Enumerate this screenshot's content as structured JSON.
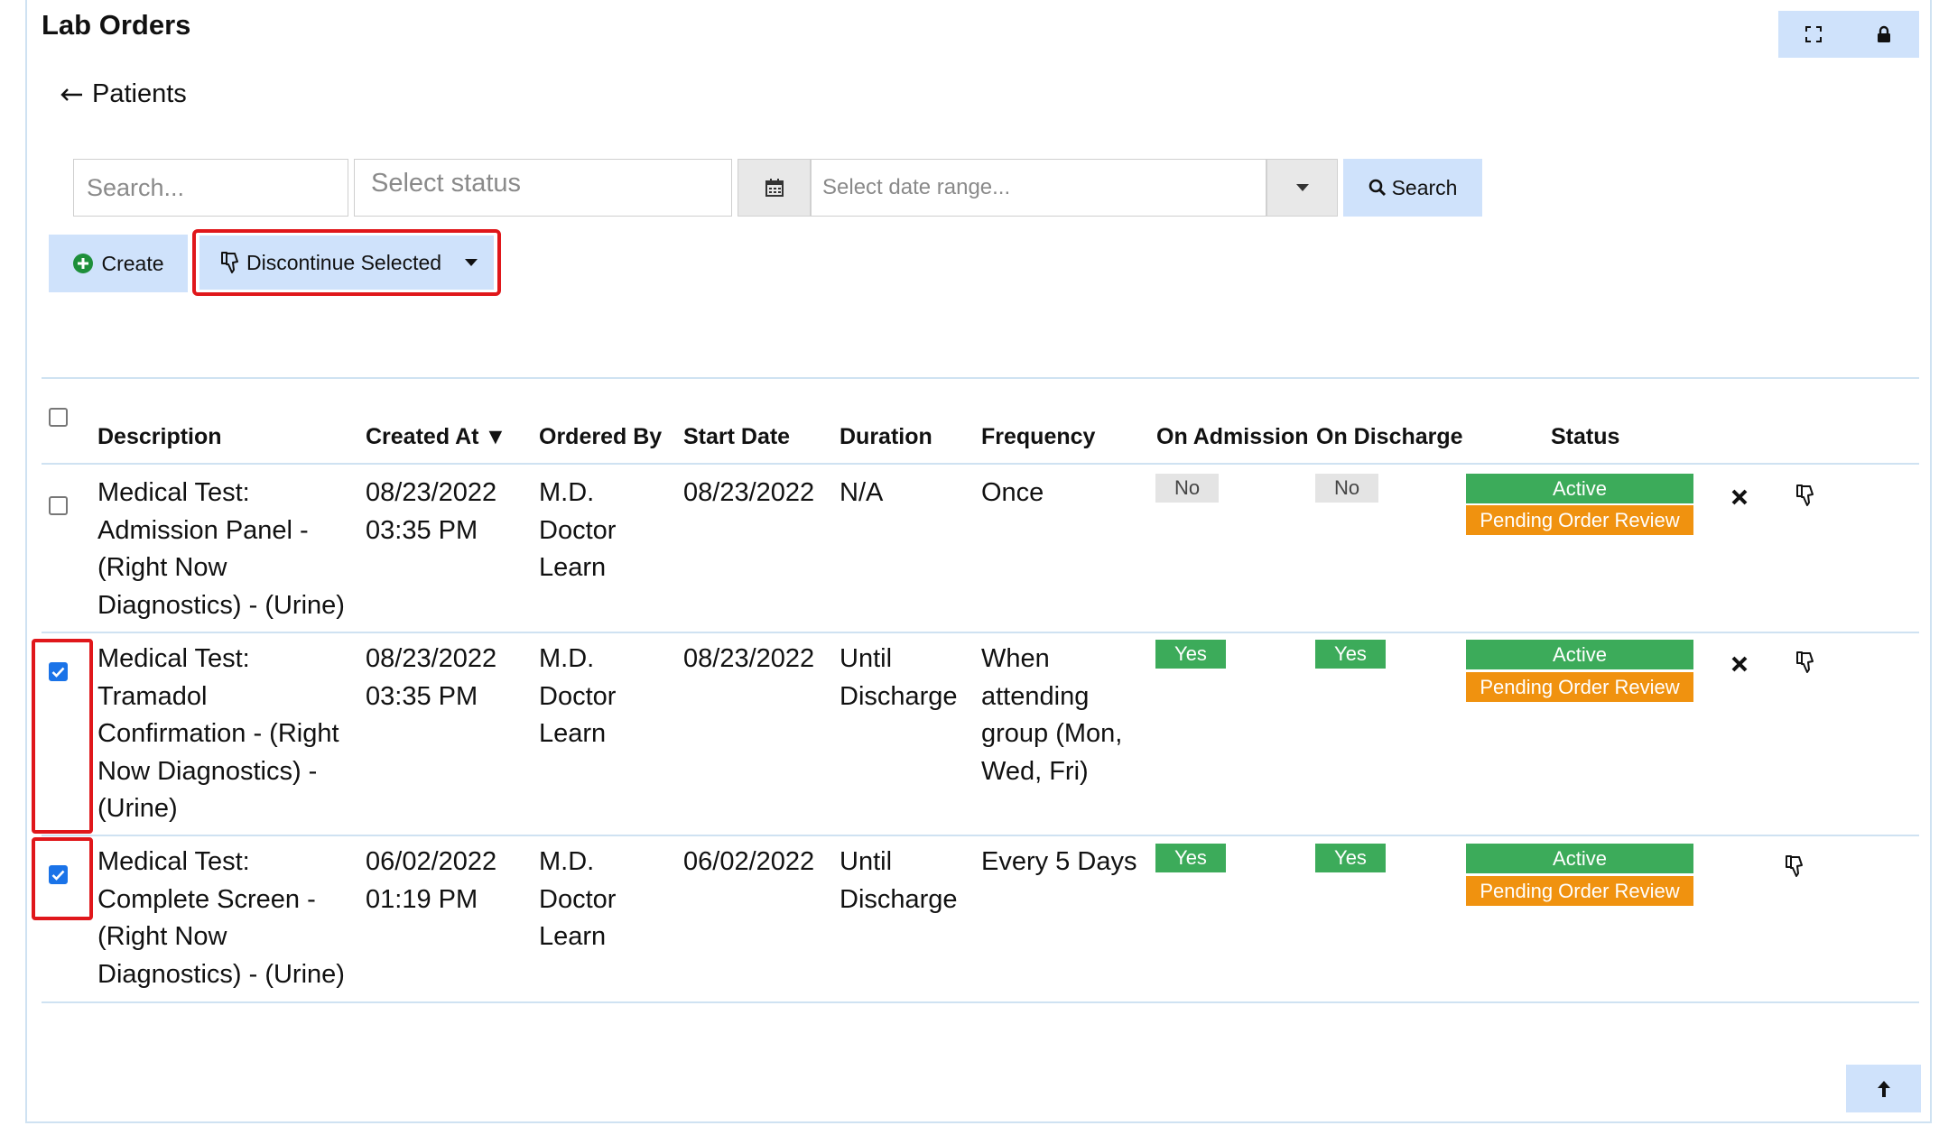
{
  "page": {
    "title": "Lab Orders",
    "back_label": "Patients"
  },
  "toolbar": {
    "expand_icon": "expand-icon",
    "lock_icon": "lock-icon"
  },
  "filters": {
    "search_placeholder": "Search...",
    "status_placeholder": "Select status",
    "date_placeholder": "Select date range...",
    "search_label": "Search"
  },
  "actions": {
    "create_label": "Create",
    "discontinue_label": "Discontinue Selected"
  },
  "table": {
    "columns": [
      "Description",
      "Created At",
      "Ordered By",
      "Start Date",
      "Duration",
      "Frequency",
      "On Admission",
      "On Discharge",
      "Status"
    ],
    "sort_indicator": "▼",
    "rows": [
      {
        "checked": false,
        "description": [
          "Medical Test:",
          "Admission Panel -",
          "(Right Now",
          "Diagnostics) - (Urine)"
        ],
        "created_at": [
          "08/23/2022",
          "03:35 PM"
        ],
        "ordered_by": [
          "M.D.",
          "Doctor",
          "Learn"
        ],
        "start_date": "08/23/2022",
        "duration": [
          "N/A"
        ],
        "frequency": [
          "Once"
        ],
        "on_admission": "No",
        "on_discharge": "No",
        "status": [
          "Active",
          "Pending Order Review"
        ],
        "has_cancel": true
      },
      {
        "checked": true,
        "description": [
          "Medical Test:",
          "Tramadol",
          "Confirmation - (Right",
          "Now Diagnostics) -",
          "(Urine)"
        ],
        "created_at": [
          "08/23/2022",
          "03:35 PM"
        ],
        "ordered_by": [
          "M.D.",
          "Doctor",
          "Learn"
        ],
        "start_date": "08/23/2022",
        "duration": [
          "Until",
          "Discharge"
        ],
        "frequency": [
          "When",
          "attending",
          "group (Mon,",
          "Wed, Fri)"
        ],
        "on_admission": "Yes",
        "on_discharge": "Yes",
        "status": [
          "Active",
          "Pending Order Review"
        ],
        "has_cancel": true
      },
      {
        "checked": true,
        "description": [
          "Medical Test:",
          "Complete Screen -",
          "(Right Now",
          "Diagnostics) - (Urine)"
        ],
        "created_at": [
          "06/02/2022",
          "01:19 PM"
        ],
        "ordered_by": [
          "M.D.",
          "Doctor",
          "Learn"
        ],
        "start_date": "06/02/2022",
        "duration": [
          "Until",
          "Discharge"
        ],
        "frequency": [
          "Every 5 Days"
        ],
        "on_admission": "Yes",
        "on_discharge": "Yes",
        "status": [
          "Active",
          "Pending Order Review"
        ],
        "has_cancel": false
      }
    ]
  },
  "colors": {
    "accent_button": "#cfe2fb",
    "active": "#3cab5a",
    "pending": "#f0920f",
    "highlight": "#e0171b",
    "checkbox": "#1a73e8"
  }
}
